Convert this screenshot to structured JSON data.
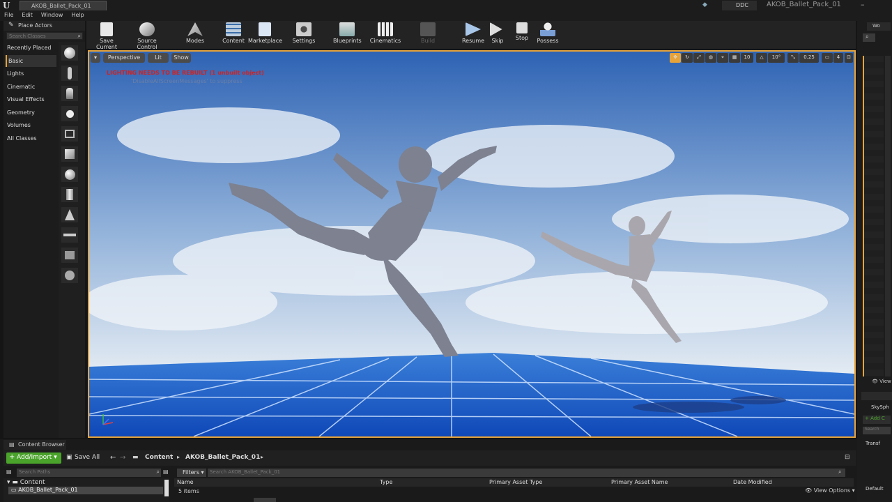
{
  "window": {
    "tab_title": "AKOB_Ballet_Pack_01",
    "project_name": "AKOB_Ballet_Pack_01",
    "ddc_label": "DDC",
    "menu": [
      "File",
      "Edit",
      "Window",
      "Help"
    ]
  },
  "place_actors": {
    "title": "Place Actors",
    "search_placeholder": "Search Classes",
    "categories": [
      "Recently Placed",
      "Basic",
      "Lights",
      "Cinematic",
      "Visual Effects",
      "Geometry",
      "Volumes",
      "All Classes"
    ],
    "active_category": "Basic"
  },
  "toolbar": {
    "buttons": [
      {
        "label": "Save Current",
        "icon": "save-icon"
      },
      {
        "label": "Source Control",
        "icon": "source-control-icon"
      },
      {
        "label": "Modes",
        "icon": "modes-icon"
      },
      {
        "label": "Content",
        "icon": "content-icon"
      },
      {
        "label": "Marketplace",
        "icon": "marketplace-icon"
      },
      {
        "label": "Settings",
        "icon": "settings-icon"
      },
      {
        "label": "Blueprints",
        "icon": "blueprints-icon"
      },
      {
        "label": "Cinematics",
        "icon": "cinematics-icon"
      },
      {
        "label": "Build",
        "icon": "build-icon",
        "disabled": true
      },
      {
        "label": "Resume",
        "icon": "resume-icon"
      },
      {
        "label": "Skip",
        "icon": "skip-icon"
      },
      {
        "label": "Stop",
        "icon": "stop-icon"
      },
      {
        "label": "Possess",
        "icon": "possess-icon"
      }
    ]
  },
  "viewport": {
    "perspective_label": "Perspective",
    "lit_label": "Lit",
    "show_label": "Show",
    "grid_snap": "10",
    "rotation_snap": "10°",
    "scale_snap": "0.25",
    "camera_speed": "4",
    "warning": "LIGHTING NEEDS TO BE REBUILT (1 unbuilt object)",
    "warning_hint": "'DisableAllScreenMessages' to suppress"
  },
  "content_browser": {
    "title": "Content Browser",
    "add_import_label": "Add/Import",
    "save_all_label": "Save All",
    "breadcrumb": [
      "Content",
      "AKOB_Ballet_Pack_01"
    ],
    "path_search_placeholder": "Search Paths",
    "filters_label": "Filters",
    "asset_search_placeholder": "Search AKOB_Ballet_Pack_01",
    "tree": {
      "root": "Content",
      "child": "AKOB_Ballet_Pack_01"
    },
    "columns": [
      "Name",
      "Type",
      "Primary Asset Type",
      "Primary Asset Name",
      "Date Modified"
    ],
    "item_count": "5 items",
    "view_options_label": "View Options"
  },
  "right_panel": {
    "tab_label": "Wo",
    "sky_sphere": "SkySph",
    "add_component": "+ Add C",
    "search": "Search",
    "transform": "Transf",
    "view_label": "View",
    "default_label": "Default"
  },
  "colors": {
    "accent": "#e6a33a",
    "add_button": "#4aa32b",
    "warning": "#d02222"
  }
}
